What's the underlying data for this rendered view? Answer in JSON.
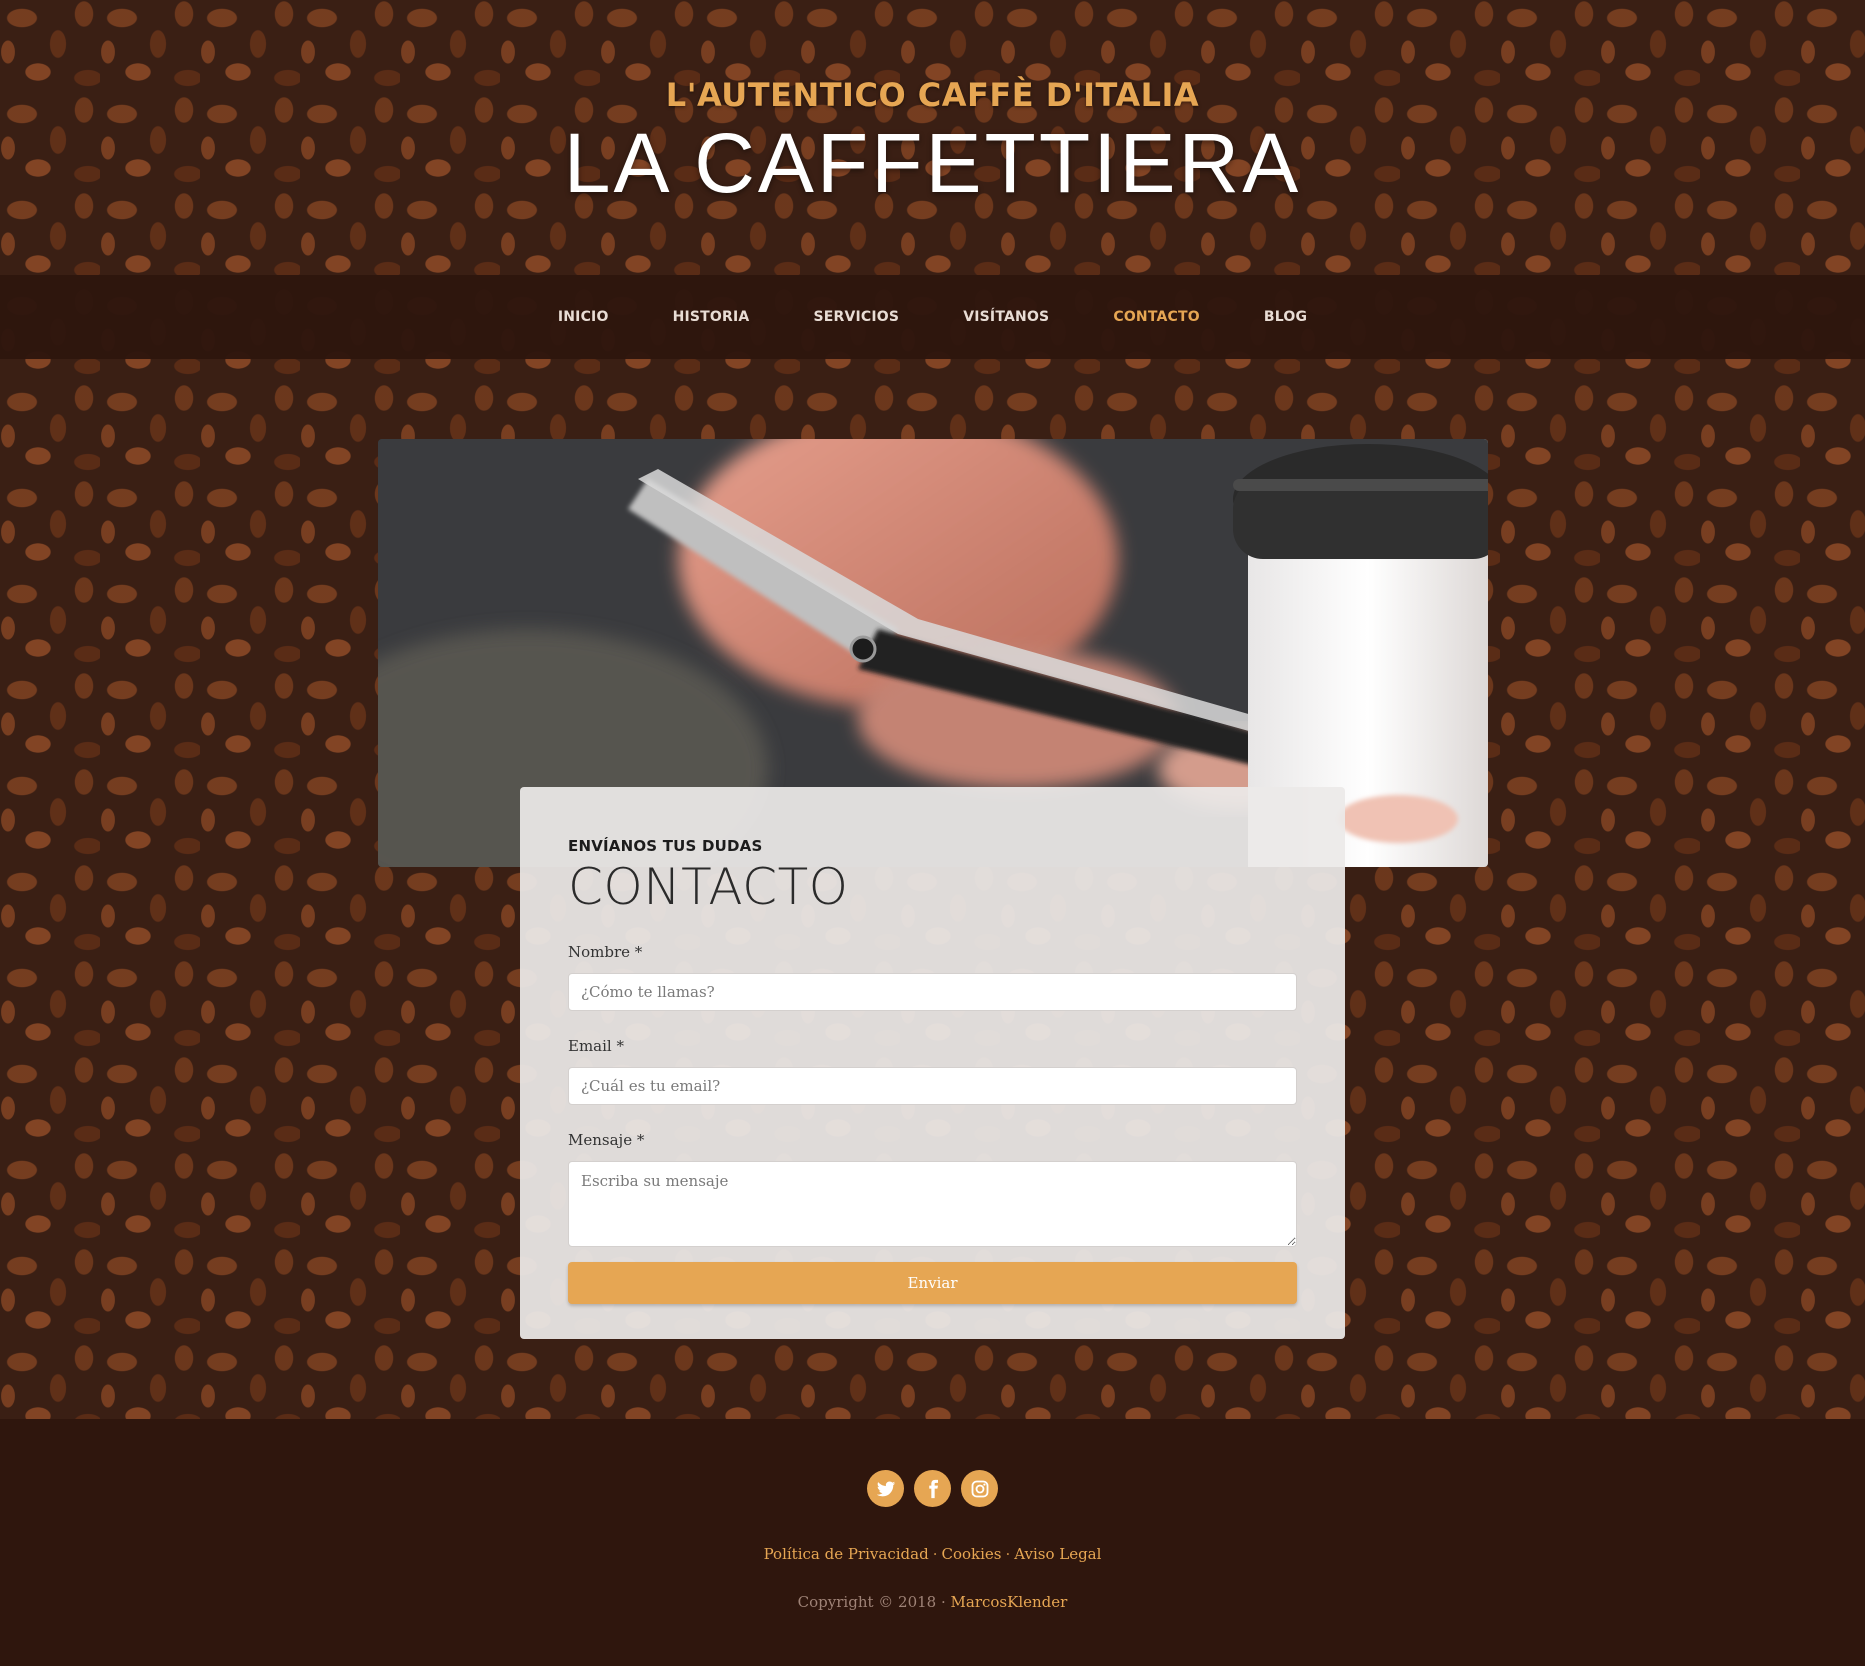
{
  "header": {
    "tagline": "L'AUTENTICO CAFFÈ D'ITALIA",
    "brand": "LA CAFFETTIERA"
  },
  "nav": {
    "items": [
      {
        "label": "INICIO"
      },
      {
        "label": "HISTORIA"
      },
      {
        "label": "SERVICIOS"
      },
      {
        "label": "VISÍTANOS"
      },
      {
        "label": "CONTACTO",
        "active": true
      },
      {
        "label": "BLOG"
      }
    ]
  },
  "contact": {
    "subheading": "ENVÍANOS TUS DUDAS",
    "title": "CONTACTO",
    "name_label": "Nombre *",
    "name_placeholder": "¿Cómo te llamas?",
    "email_label": "Email *",
    "email_placeholder": "¿Cuál es tu email?",
    "message_label": "Mensaje *",
    "message_placeholder": "Escriba su mensaje",
    "submit_label": "Enviar"
  },
  "footer": {
    "social": [
      "twitter-icon",
      "facebook-icon",
      "instagram-icon"
    ],
    "links": {
      "privacy": "Política de Privacidad",
      "cookies": "Cookies",
      "legal": "Aviso Legal",
      "separator": "·"
    },
    "copyright_text": "Copyright © 2018 · ",
    "author": "MarcosKlender"
  },
  "colors": {
    "accent": "#e6a653",
    "nav_bg": "#2e160e",
    "footer_bg": "#2f160d",
    "card_bg": "#ece9e8"
  }
}
